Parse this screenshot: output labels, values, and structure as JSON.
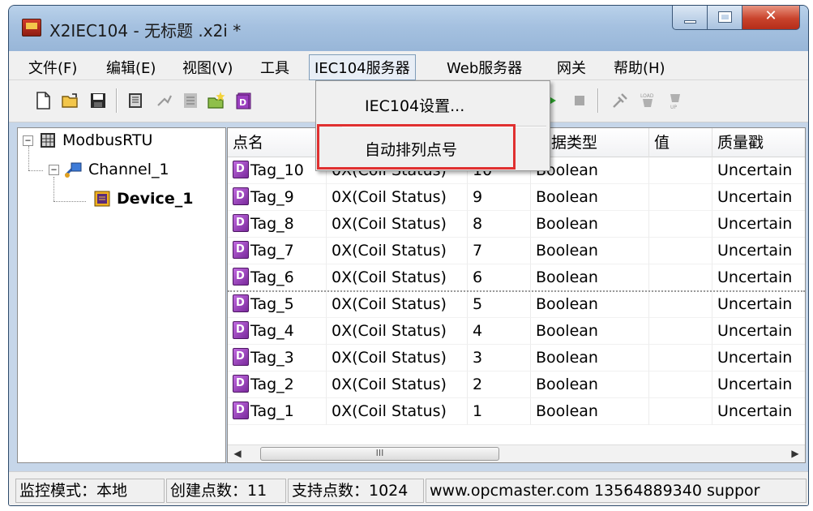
{
  "window": {
    "title": "X2IEC104 - 无标题 .x2i *"
  },
  "menu": {
    "items": [
      "文件(F)",
      "编辑(E)",
      "视图(V)",
      "工具",
      "IEC104服务器",
      "Web服务器",
      "网关",
      "帮助(H)"
    ],
    "active": "IEC104服务器"
  },
  "dropdown": {
    "items": [
      "IEC104设置...",
      "自动排列点号"
    ],
    "highlighted": "自动排列点号"
  },
  "tree": {
    "root": "ModbusRTU",
    "channel": "Channel_1",
    "device": "Device_1"
  },
  "table": {
    "columns": [
      "点名",
      "数据类型",
      "值",
      "质量戳"
    ],
    "rows": [
      {
        "name": "Tag_10",
        "register": "0X(Coil Status)",
        "addr": "10",
        "type": "Boolean",
        "value": "",
        "quality": "Uncertain"
      },
      {
        "name": "Tag_9",
        "register": "0X(Coil Status)",
        "addr": "9",
        "type": "Boolean",
        "value": "",
        "quality": "Uncertain"
      },
      {
        "name": "Tag_8",
        "register": "0X(Coil Status)",
        "addr": "8",
        "type": "Boolean",
        "value": "",
        "quality": "Uncertain"
      },
      {
        "name": "Tag_7",
        "register": "0X(Coil Status)",
        "addr": "7",
        "type": "Boolean",
        "value": "",
        "quality": "Uncertain"
      },
      {
        "name": "Tag_6",
        "register": "0X(Coil Status)",
        "addr": "6",
        "type": "Boolean",
        "value": "",
        "quality": "Uncertain"
      },
      {
        "name": "Tag_5",
        "register": "0X(Coil Status)",
        "addr": "5",
        "type": "Boolean",
        "value": "",
        "quality": "Uncertain"
      },
      {
        "name": "Tag_4",
        "register": "0X(Coil Status)",
        "addr": "4",
        "type": "Boolean",
        "value": "",
        "quality": "Uncertain"
      },
      {
        "name": "Tag_3",
        "register": "0X(Coil Status)",
        "addr": "3",
        "type": "Boolean",
        "value": "",
        "quality": "Uncertain"
      },
      {
        "name": "Tag_2",
        "register": "0X(Coil Status)",
        "addr": "2",
        "type": "Boolean",
        "value": "",
        "quality": "Uncertain"
      },
      {
        "name": "Tag_1",
        "register": "0X(Coil Status)",
        "addr": "1",
        "type": "Boolean",
        "value": "",
        "quality": "Uncertain"
      }
    ]
  },
  "scrollbar": {
    "thumb_grip": "III"
  },
  "status": {
    "mode": "监控模式：本地",
    "created": "创建点数：11",
    "supported": "支持点数：1024",
    "contact": "www.opcmaster.com 13564889340 suppor"
  },
  "colors": {
    "highlight_box": "#e03030",
    "tag_icon": "#9b3fc0",
    "close_button": "#c9432c"
  }
}
